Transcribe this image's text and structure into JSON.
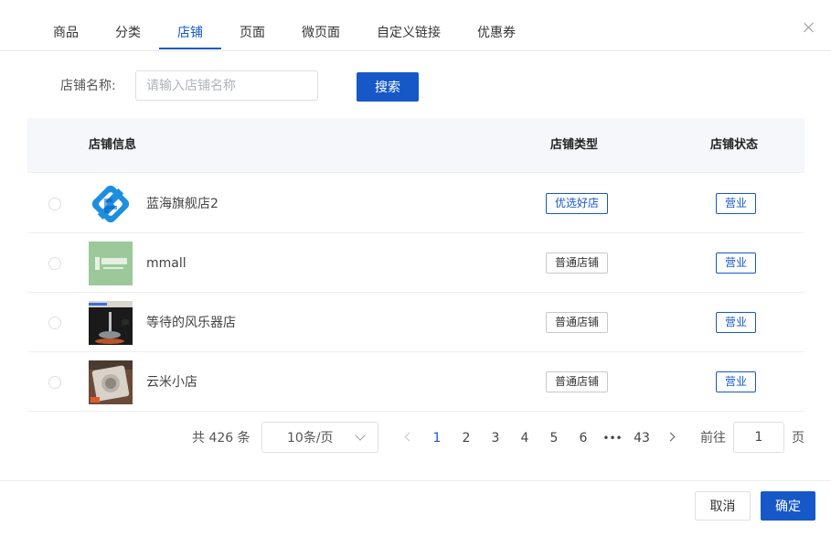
{
  "tabs": [
    {
      "label": "商品",
      "active": false
    },
    {
      "label": "分类",
      "active": false
    },
    {
      "label": "店铺",
      "active": true
    },
    {
      "label": "页面",
      "active": false
    },
    {
      "label": "微页面",
      "active": false
    },
    {
      "label": "自定义链接",
      "active": false
    },
    {
      "label": "优惠券",
      "active": false
    }
  ],
  "search": {
    "label": "店铺名称:",
    "placeholder": "请输入店铺名称",
    "value": "",
    "button": "搜索"
  },
  "table": {
    "headers": {
      "info": "店铺信息",
      "type": "店铺类型",
      "status": "店铺状态"
    },
    "rows": [
      {
        "name": "蓝海旗舰店2",
        "type": "优选好店",
        "type_style": "blue",
        "status": "营业",
        "thumb": "blue-logo-icon"
      },
      {
        "name": "mmall",
        "type": "普通店铺",
        "type_style": "gray",
        "status": "营业",
        "thumb": "green-banner-icon"
      },
      {
        "name": "等待的风乐器店",
        "type": "普通店铺",
        "type_style": "gray",
        "status": "营业",
        "thumb": "instrument-photo-icon"
      },
      {
        "name": "云米小店",
        "type": "普通店铺",
        "type_style": "gray",
        "status": "营业",
        "thumb": "appliance-photo-icon"
      }
    ]
  },
  "pagination": {
    "total": "共 426 条",
    "page_size": "10条/页",
    "pages": [
      "1",
      "2",
      "3",
      "4",
      "5",
      "6",
      "•••",
      "43"
    ],
    "current": "1",
    "goto_label": "前往",
    "goto_value": "1",
    "goto_suffix": "页"
  },
  "footer": {
    "cancel": "取消",
    "confirm": "确定"
  },
  "colors": {
    "accent": "#1658c8",
    "border": "#dcdfe6",
    "header_bg": "#f5f7fa"
  }
}
